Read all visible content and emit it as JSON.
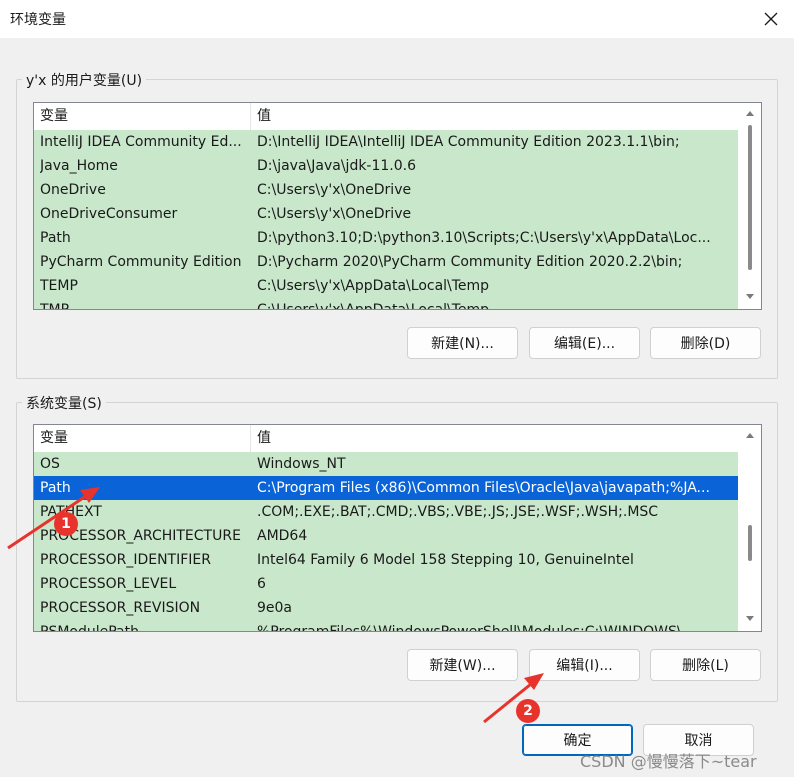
{
  "window": {
    "title": "环境变量"
  },
  "user_vars": {
    "label": "y'x 的用户变量(U)",
    "columns": [
      "变量",
      "值"
    ],
    "rows": [
      {
        "name": "IntelliJ IDEA Community Ed...",
        "value": "D:\\IntelliJ IDEA\\IntelliJ IDEA Community Edition 2023.1.1\\bin;"
      },
      {
        "name": "Java_Home",
        "value": "D:\\java\\Java\\jdk-11.0.6"
      },
      {
        "name": "OneDrive",
        "value": "C:\\Users\\y'x\\OneDrive"
      },
      {
        "name": "OneDriveConsumer",
        "value": "C:\\Users\\y'x\\OneDrive"
      },
      {
        "name": "Path",
        "value": "D:\\python3.10;D:\\python3.10\\Scripts;C:\\Users\\y'x\\AppData\\Loc..."
      },
      {
        "name": "PyCharm Community Edition",
        "value": "D:\\Pycharm 2020\\PyCharm Community Edition 2020.2.2\\bin;"
      },
      {
        "name": "TEMP",
        "value": "C:\\Users\\y'x\\AppData\\Local\\Temp"
      },
      {
        "name": "TMP",
        "value": "C:\\Users\\y'x\\AppData\\Local\\Temp"
      }
    ],
    "buttons": {
      "new": "新建(N)...",
      "edit": "编辑(E)...",
      "delete": "删除(D)"
    }
  },
  "system_vars": {
    "label": "系统变量(S)",
    "columns": [
      "变量",
      "值"
    ],
    "rows": [
      {
        "name": "OS",
        "value": "Windows_NT"
      },
      {
        "name": "Path",
        "value": "C:\\Program Files (x86)\\Common Files\\Oracle\\Java\\javapath;%JA..."
      },
      {
        "name": "PATHEXT",
        "value": ".COM;.EXE;.BAT;.CMD;.VBS;.VBE;.JS;.JSE;.WSF;.WSH;.MSC"
      },
      {
        "name": "PROCESSOR_ARCHITECTURE",
        "value": "AMD64"
      },
      {
        "name": "PROCESSOR_IDENTIFIER",
        "value": "Intel64 Family 6 Model 158 Stepping 10, GenuineIntel"
      },
      {
        "name": "PROCESSOR_LEVEL",
        "value": "6"
      },
      {
        "name": "PROCESSOR_REVISION",
        "value": "9e0a"
      },
      {
        "name": "PSModulePath",
        "value": "%ProgramFiles%\\WindowsPowerShell\\Modules;C:\\WINDOWS\\..."
      }
    ],
    "selected_index": 1,
    "buttons": {
      "new": "新建(W)...",
      "edit": "编辑(I)...",
      "delete": "删除(L)"
    }
  },
  "footer": {
    "ok": "确定",
    "cancel": "取消"
  },
  "annotations": {
    "step1": "1",
    "step2": "2",
    "color": "#e7332b"
  },
  "watermark": "CSDN @慢慢落下~tear",
  "colors": {
    "row_bg": "#c9e7cb",
    "selected_bg": "#0a64d8",
    "accent": "#0067c0"
  },
  "icons": {
    "close": "close-icon",
    "scroll_up": "chevron-up-icon",
    "scroll_down": "chevron-down-icon"
  }
}
